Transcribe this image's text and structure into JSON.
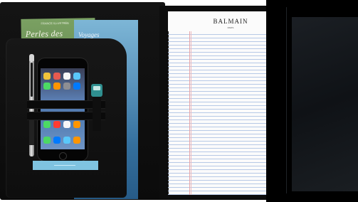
{
  "scene": "black leather portfolio with phone, pen, brochures, notepad and tablet",
  "brochure_green": {
    "title": "Perles des",
    "small_text": "FRANCE ILLUSTRÉE"
  },
  "brochure_blue": {
    "title": "Voyages"
  },
  "notepad": {
    "brand": "BALMAIN",
    "brand_sub": "PARIS"
  },
  "colors": {
    "leather": "#0e0e0e",
    "paper": "#fbfbfb",
    "ruling": "#b7c9e6",
    "margin": "#e7a4a8",
    "card": "#7fc3e0"
  }
}
